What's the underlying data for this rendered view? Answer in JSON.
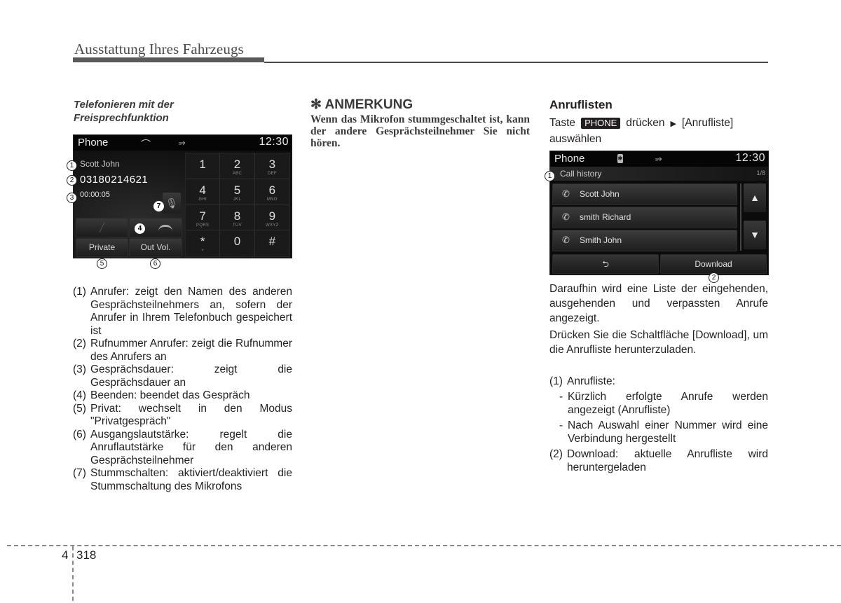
{
  "header": {
    "title": "Ausstattung Ihres Fahrzeugs"
  },
  "left": {
    "subheading": [
      "Telefonieren mit der",
      "Freisprechfunktion"
    ],
    "screen": {
      "title": "Phone",
      "clock": "12:30",
      "icons": {
        "status_call": "phone-handset-icon",
        "usb": "usb-icon"
      },
      "caller_name": "Scott John",
      "caller_number": "03180214621",
      "duration": "00:00:05",
      "buttons": {
        "private": "Private",
        "out_vol": "Out Vol."
      },
      "keypad": [
        {
          "digit": "1",
          "letters": ""
        },
        {
          "digit": "2",
          "letters": "ABC"
        },
        {
          "digit": "3",
          "letters": "DEF"
        },
        {
          "digit": "4",
          "letters": "GHI"
        },
        {
          "digit": "5",
          "letters": "JKL"
        },
        {
          "digit": "6",
          "letters": "MNO"
        },
        {
          "digit": "7",
          "letters": "PQRS"
        },
        {
          "digit": "8",
          "letters": "TUV"
        },
        {
          "digit": "9",
          "letters": "WXYZ"
        },
        {
          "digit": "*",
          "letters": "+"
        },
        {
          "digit": "0",
          "letters": ""
        },
        {
          "digit": "#",
          "letters": ""
        }
      ],
      "callouts": [
        "1",
        "2",
        "3",
        "4",
        "5",
        "6",
        "7"
      ]
    },
    "items": [
      {
        "num": "(1)",
        "text": "Anrufer: zeigt den Namen des anderen Gesprächsteilnehmers an, sofern der Anrufer in Ihrem Telefonbuch gespeichert ist"
      },
      {
        "num": "(2)",
        "text": "Rufnummer Anrufer: zeigt die Rufnummer des Anrufers an"
      },
      {
        "num": "(3)",
        "text": "Gesprächsdauer: zeigt die Gesprächsdauer an"
      },
      {
        "num": "(4)",
        "text": "Beenden: beendet das Gespräch"
      },
      {
        "num": "(5)",
        "text": "Privat: wechselt in den Modus \"Privatgespräch\""
      },
      {
        "num": "(6)",
        "text": "Ausgangslautstärke: regelt die Anruflautstärke für den anderen Gesprächsteilnehmer"
      },
      {
        "num": "(7)",
        "text": "Stummschalten: aktiviert/deaktiviert die Stummschaltung des Mikrofons"
      }
    ]
  },
  "middle": {
    "note_heading": "✻ ANMERKUNG",
    "note_body": "Wenn das Mikrofon stummgeschaltet ist, kann der andere Gesprächsteilnehmer Sie nicht hören."
  },
  "right": {
    "heading": "Anruflisten",
    "instruction": {
      "prefix": "Taste",
      "key": "PHONE",
      "mid": "drücken",
      "suffix": "[Anrufliste] auswählen"
    },
    "screen": {
      "title": "Phone",
      "clock": "12:30",
      "subtitle": "Call history",
      "page": "1/8",
      "entries": [
        {
          "name": "Scott John",
          "icon": "missed-call-icon"
        },
        {
          "name": "smith Richard",
          "icon": "outgoing-call-icon"
        },
        {
          "name": "Smith John",
          "icon": "outgoing-call-icon"
        }
      ],
      "back_label": "⮌",
      "download_label": "Download",
      "callouts": [
        "1",
        "2"
      ]
    },
    "para1": "Daraufhin wird eine Liste der eingehenden, ausgehenden und verpassten Anrufe angezeigt.",
    "para2": "Drücken Sie die Schaltfläche [Download], um die Anrufliste herunterzuladen.",
    "items": [
      {
        "num": "(1)",
        "text": "Anrufliste:"
      },
      {
        "num": "-",
        "text": "Kürzlich erfolgte Anrufe werden angezeigt (Anrufliste)",
        "sub": true
      },
      {
        "num": "-",
        "text": "Nach Auswahl einer Nummer wird eine Verbindung hergestellt",
        "sub": true
      },
      {
        "num": "(2)",
        "text": "Download: aktuelle Anrufliste wird heruntergeladen"
      }
    ]
  },
  "footer": {
    "chapter": "4",
    "page": "318"
  }
}
